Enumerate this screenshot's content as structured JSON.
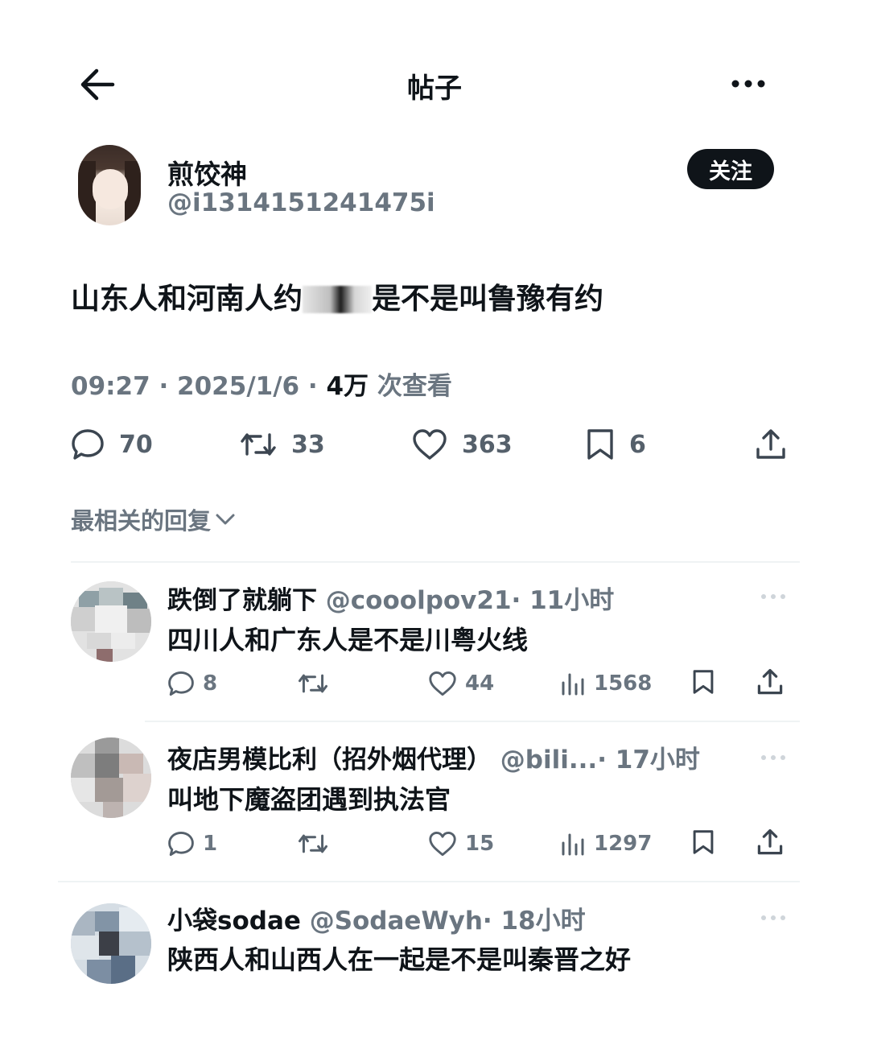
{
  "header": {
    "title": "帖子",
    "back_icon": "arrow-left-icon",
    "more_icon": "more-horizontal-icon"
  },
  "author": {
    "name": "煎饺神",
    "handle": "@i1314151241475i",
    "follow_label": "关注"
  },
  "post": {
    "text_before": "山东人和河南人约",
    "text_after": "是不是叫鲁豫有约",
    "time": "09:27 · 2025/1/6 · ",
    "views_count": "4万",
    "views_label": " 次查看"
  },
  "stats": {
    "comments": "70",
    "reposts": "33",
    "likes": "363",
    "bookmarks": "6"
  },
  "sort": {
    "label": "最相关的回复"
  },
  "replies": [
    {
      "name": "跌倒了就躺下",
      "handle": "@cooolpov21",
      "time": "· 11小时",
      "text": "四川人和广东人是不是川粤火线",
      "comments": "8",
      "reposts": "",
      "likes": "44",
      "views": "1568"
    },
    {
      "name": "夜店男模比利（招外烟代理）",
      "handle": "@bili...",
      "time": "· 17小时",
      "text": "叫地下魔盗团遇到执法官",
      "comments": "1",
      "reposts": "",
      "likes": "15",
      "views": "1297"
    },
    {
      "name": "小袋sodae",
      "handle": "@SodaeWyh",
      "time": "· 18小时",
      "text": "陕西人和山西人在一起是不是叫秦晋之好"
    }
  ],
  "colors": {
    "text": "#0f1419",
    "secondary": "#6a7580",
    "divider": "#eff3f4",
    "button": "#0f1419"
  }
}
